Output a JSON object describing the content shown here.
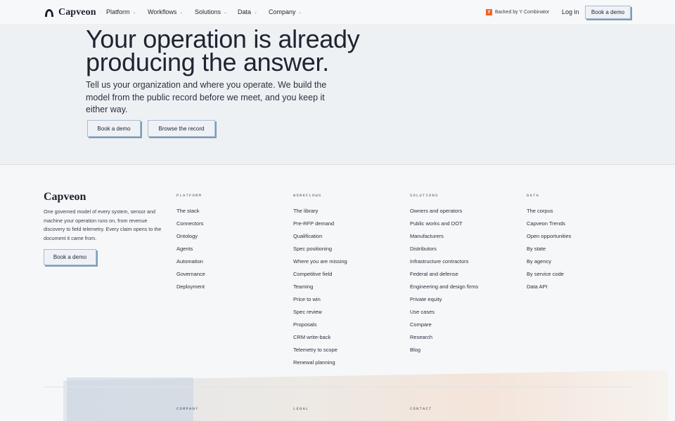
{
  "nav": {
    "brand": "Capveon",
    "menu": [
      {
        "label": "Platform"
      },
      {
        "label": "Workflows"
      },
      {
        "label": "Solutions"
      },
      {
        "label": "Data"
      },
      {
        "label": "Company"
      }
    ],
    "yc_badge": "Y",
    "yc_text": "Backed by Y Combinator",
    "login": "Log in",
    "cta": "Book a demo"
  },
  "hero": {
    "title": "Your operation is already producing the answer.",
    "subtitle": "Tell us your organization and where you operate. We build the model from the public record before we meet, and you keep it either way.",
    "primary_cta": "Book a demo",
    "secondary_cta": "Browse the record"
  },
  "footer": {
    "brand": "Capveon",
    "description": "One governed model of every system, sensor and machine your operation runs on, from revenue discovery to field telemetry. Every claim opens to the document it came from.",
    "cta": "Book a demo",
    "columns": [
      {
        "heading": "Platform",
        "items": [
          "The stack",
          "Connectors",
          "Ontology",
          "Agents",
          "Automation",
          "Governance",
          "Deployment"
        ]
      },
      {
        "heading": "Workflows",
        "items": [
          "The library",
          "Pre-RFP demand",
          "Qualification",
          "Spec positioning",
          "Where you are missing",
          "Competitive field",
          "Teaming",
          "Price to win",
          "Spec review",
          "Proposals",
          "CRM write-back",
          "Telemetry to scope",
          "Renewal planning"
        ]
      },
      {
        "heading": "Solutions",
        "items": [
          "Owners and operators",
          "Public works and DOT",
          "Manufacturers",
          "Distributors",
          "Infrastructure contractors",
          "Federal and defense",
          "Engineering and design firms",
          "Private equity",
          "Use cases",
          "Compare",
          "Research",
          "Blog"
        ]
      },
      {
        "heading": "Data",
        "items": [
          "The corpus",
          "Capveon Trends",
          "Open opportunities",
          "By state",
          "By agency",
          "By service code",
          "Data API"
        ]
      }
    ],
    "bottom_headings": [
      "Company",
      "Legal",
      "Contact"
    ]
  }
}
